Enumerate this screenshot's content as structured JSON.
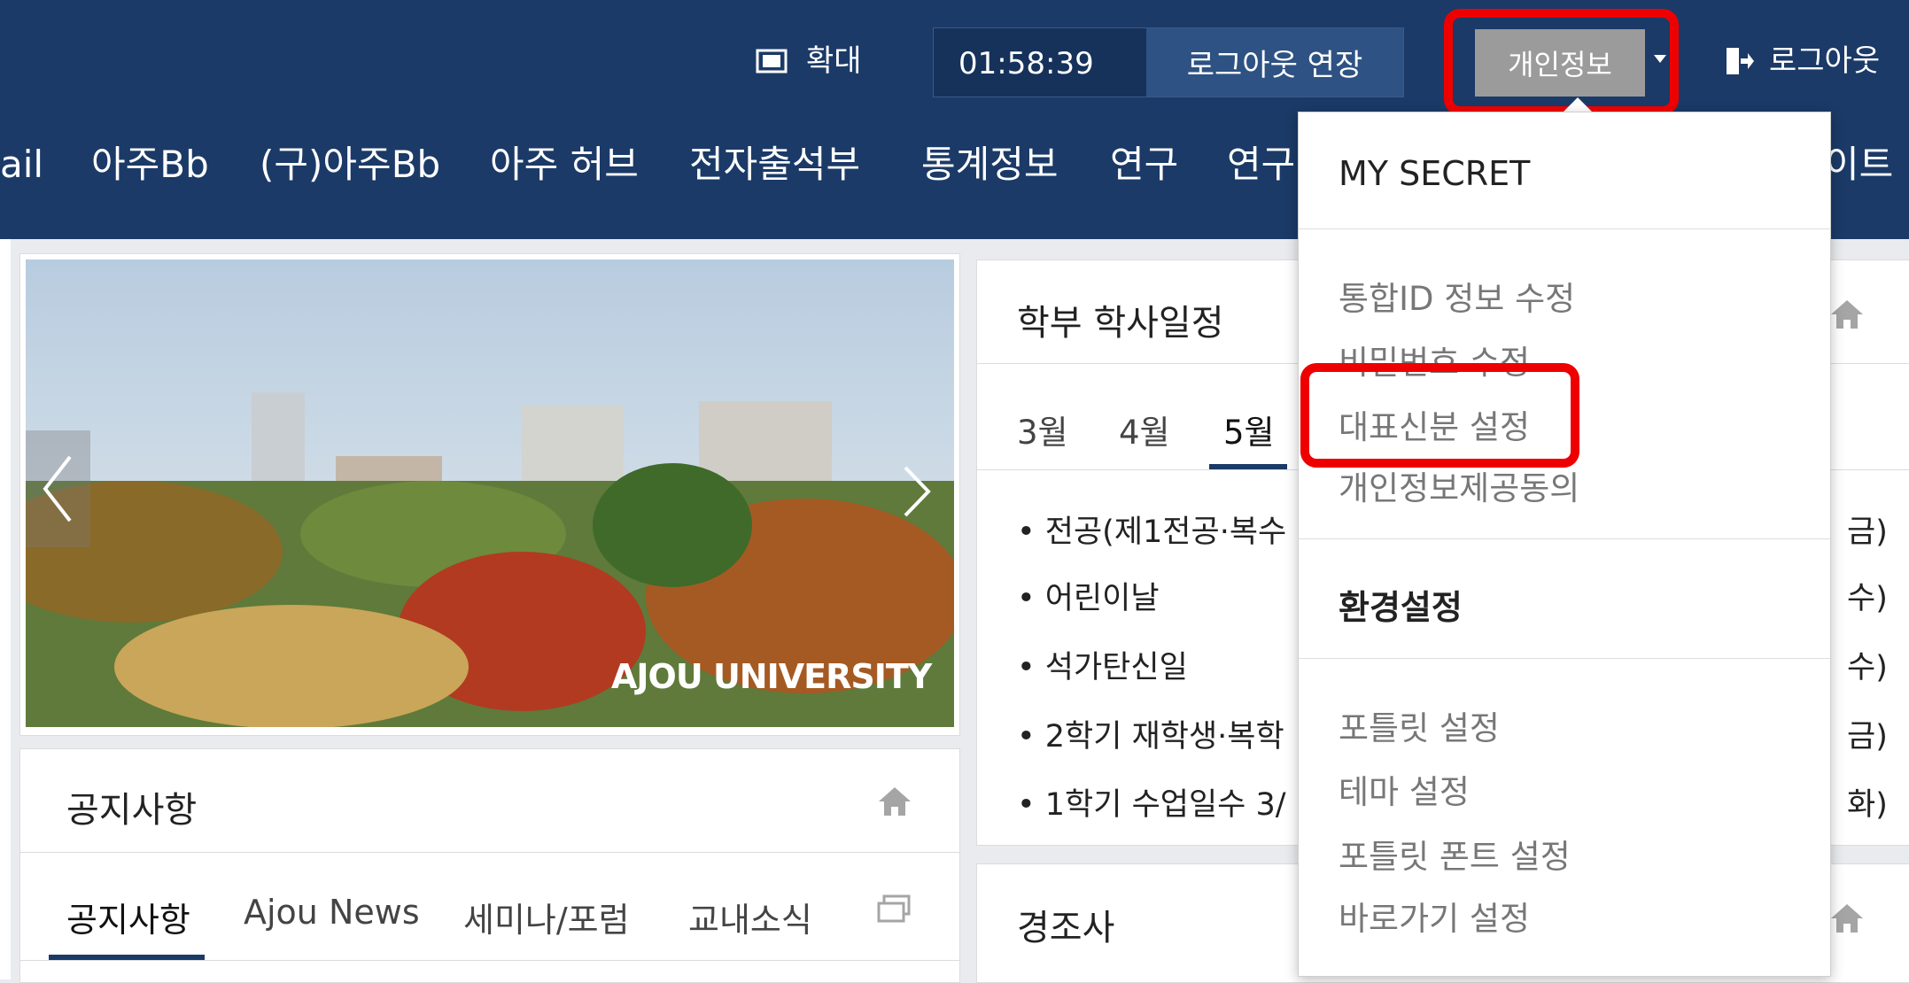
{
  "topbar": {
    "zoom_label": "확대",
    "timer": "01:58:39",
    "extend_label": "로그아웃 연장",
    "myinfo_label": "개인정보",
    "logout_label": "로그아웃"
  },
  "nav": {
    "items": [
      "ail",
      "아주Bb",
      "(구)아주Bb",
      "아주 허브",
      "전자출석부",
      "통계정보",
      "연구",
      "연구",
      "이트"
    ]
  },
  "dropdown": {
    "section1_title": "MY SECRET",
    "section1_items": [
      "통합ID 정보 수정",
      "비밀번호 수정",
      "대표신분 설정",
      "개인정보제공동의"
    ],
    "section2_title": "환경설정",
    "section2_items": [
      "포틀릿 설정",
      "테마 설정",
      "포틀릿 폰트 설정",
      "바로가기 설정"
    ]
  },
  "banner": {
    "logo_text": "AJOU UNIVERSITY"
  },
  "notice": {
    "title": "공지사항",
    "tabs": [
      "공지사항",
      "Ajou News",
      "세미나/포럼",
      "교내소식"
    ]
  },
  "schedule": {
    "title": "학부 학사일정",
    "months": [
      "3월",
      "4월",
      "5월"
    ],
    "items": [
      "• 전공(제1전공·복수",
      "• 어린이날",
      "• 석가탄신일",
      "• 2학기 재학생·복학",
      "• 1학기 수업일수 3/"
    ],
    "right_suffix": [
      "금)",
      "수)",
      "수)",
      "금)",
      "화)"
    ]
  },
  "condolence": {
    "title": "경조사"
  },
  "colors": {
    "topbar": "#1b3a67",
    "highlight": "#ef0000",
    "myinfo_button": "#9b9b9b"
  }
}
